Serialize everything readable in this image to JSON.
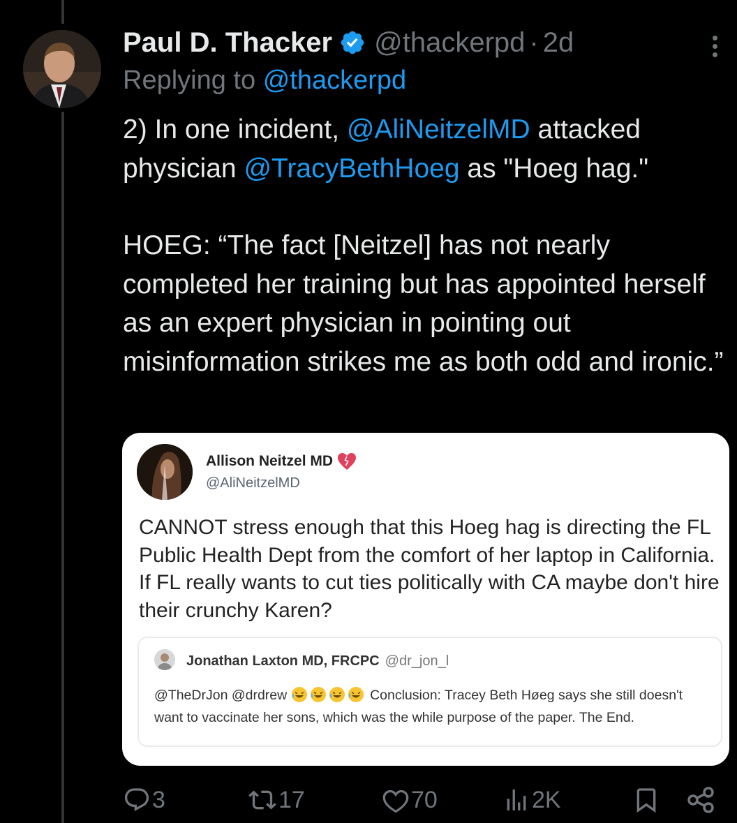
{
  "tweet": {
    "author_name": "Paul D. Thacker",
    "author_handle": "@thackerpd",
    "separator": "·",
    "time": "2d",
    "replying_prefix": "Replying to",
    "replying_handle": "@thackerpd",
    "body": {
      "p1_before_mention1": "2) In one incident,",
      "mention1": "@AliNeitzelMD",
      "p1_after_mention1": "attacked physician",
      "mention2": "@TracyBethHoeg",
      "p1_end": "as \"Hoeg hag.\"",
      "p2": "HOEG: “The fact [Neitzel] has not nearly completed her training but has appointed herself as an expert physician in pointing out misinformation strikes me as both odd and ironic.”"
    },
    "actions": {
      "reply_count": "3",
      "retweet_count": "17",
      "like_count": "70",
      "view_count": "2K"
    }
  },
  "embedded_screenshot": {
    "author_name": "Allison Neitzel MD",
    "author_handle": "@AliNeitzelMD",
    "text": "CANNOT stress enough that this Hoeg hag is directing the FL Public Health Dept from the comfort of her laptop in California. If FL really wants to cut ties politically with CA maybe don't hire their crunchy Karen?",
    "quote": {
      "author_name": "Jonathan Laxton MD, FRCPC",
      "author_handle": "@dr_jon_l",
      "text_before_emoji": "@TheDrJon @drdrew",
      "text_after_emoji": "Conclusion: Tracey Beth Høeg says she still doesn't want to vaccinate her sons, which was the while purpose of the paper.  The End."
    }
  },
  "colors": {
    "background": "#000000",
    "text": "#e7e9ea",
    "secondary_text": "#71767b",
    "link": "#1d9bf0",
    "verified": "#1d9bf0"
  },
  "icons": [
    "verified-badge-icon",
    "more-icon",
    "reply-icon",
    "retweet-icon",
    "like-icon",
    "views-icon",
    "bookmark-icon",
    "share-icon",
    "heart-emoji-icon",
    "laughing-emoji-icon"
  ]
}
